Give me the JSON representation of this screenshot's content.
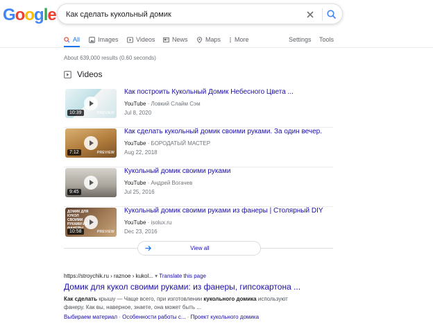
{
  "logo": {
    "parts": [
      "G",
      "o",
      "o",
      "g",
      "l",
      "e"
    ]
  },
  "search": {
    "query": "Как сделать кукольный домик"
  },
  "tabs": [
    {
      "label": "All",
      "icon": "search-icon"
    },
    {
      "label": "Images",
      "icon": "image-icon"
    },
    {
      "label": "Videos",
      "icon": "video-icon"
    },
    {
      "label": "News",
      "icon": "news-icon"
    },
    {
      "label": "Maps",
      "icon": "map-pin-icon"
    },
    {
      "label": "More",
      "icon": "more-dots-icon"
    }
  ],
  "tools": {
    "settings": "Settings",
    "tools": "Tools"
  },
  "result_stats": "About 639,000 results (0.60 seconds)",
  "videos": {
    "heading": "Videos",
    "items": [
      {
        "title": "Как построить Кукольный Домик Небесного Цвета ...",
        "source": "YouTube",
        "channel": "Ловкий Слайм Сэм",
        "date": "Jul 8, 2020",
        "duration": "10:39",
        "badge": "PREVIEW",
        "thumb_bg": "#d9ecef",
        "caption": ""
      },
      {
        "title": "Как сделать кукольный домик своими руками. За один вечер.",
        "source": "YouTube",
        "channel": "БОРОДАТЫЙ МАСТЕР",
        "date": "Aug 22, 2018",
        "duration": "7:12",
        "badge": "PREVIEW",
        "thumb_bg": "#c89a55",
        "caption": ""
      },
      {
        "title": "Кукольный домик своими руками",
        "source": "YouTube",
        "channel": "Андрей Вогачев",
        "date": "Jul 25, 2016",
        "duration": "9:45",
        "badge": "",
        "thumb_bg": "#b9b6b0",
        "caption": ""
      },
      {
        "title": "Кукольный домик своими руками из фанеры | Столярный DIY",
        "source": "YouTube",
        "channel": "isolux.ru",
        "date": "Dec 23, 2016",
        "duration": "10:58",
        "badge": "PREVIEW",
        "thumb_bg": "#8a6a4a",
        "caption": "ДОМИК ДЛЯ КУКОЛ СВОИМИ РУКАМИ ИЗ ФАНЕРЫ"
      }
    ],
    "view_all": "View all"
  },
  "result": {
    "url": "https://stroychik.ru › raznoe › kukol...",
    "translate": "Translate this page",
    "title": "Домик для кукол своими руками: из фанеры, гипсокартона ...",
    "snippet_pre": "Как сделать",
    "snippet_a": " крышу — Чаще всего, при изготовлении ",
    "snippet_b": "кукольного домика",
    "snippet_c": " используют фанеру. Как вы, наверное, знаете, она может быть ...",
    "sitelinks": [
      "Выбираем материал",
      "Особенности работы с...",
      "Проект кукольного домика"
    ]
  },
  "colors": {
    "accent": "#1a73e8",
    "link": "#1a0dab",
    "meta": "#70757a"
  }
}
